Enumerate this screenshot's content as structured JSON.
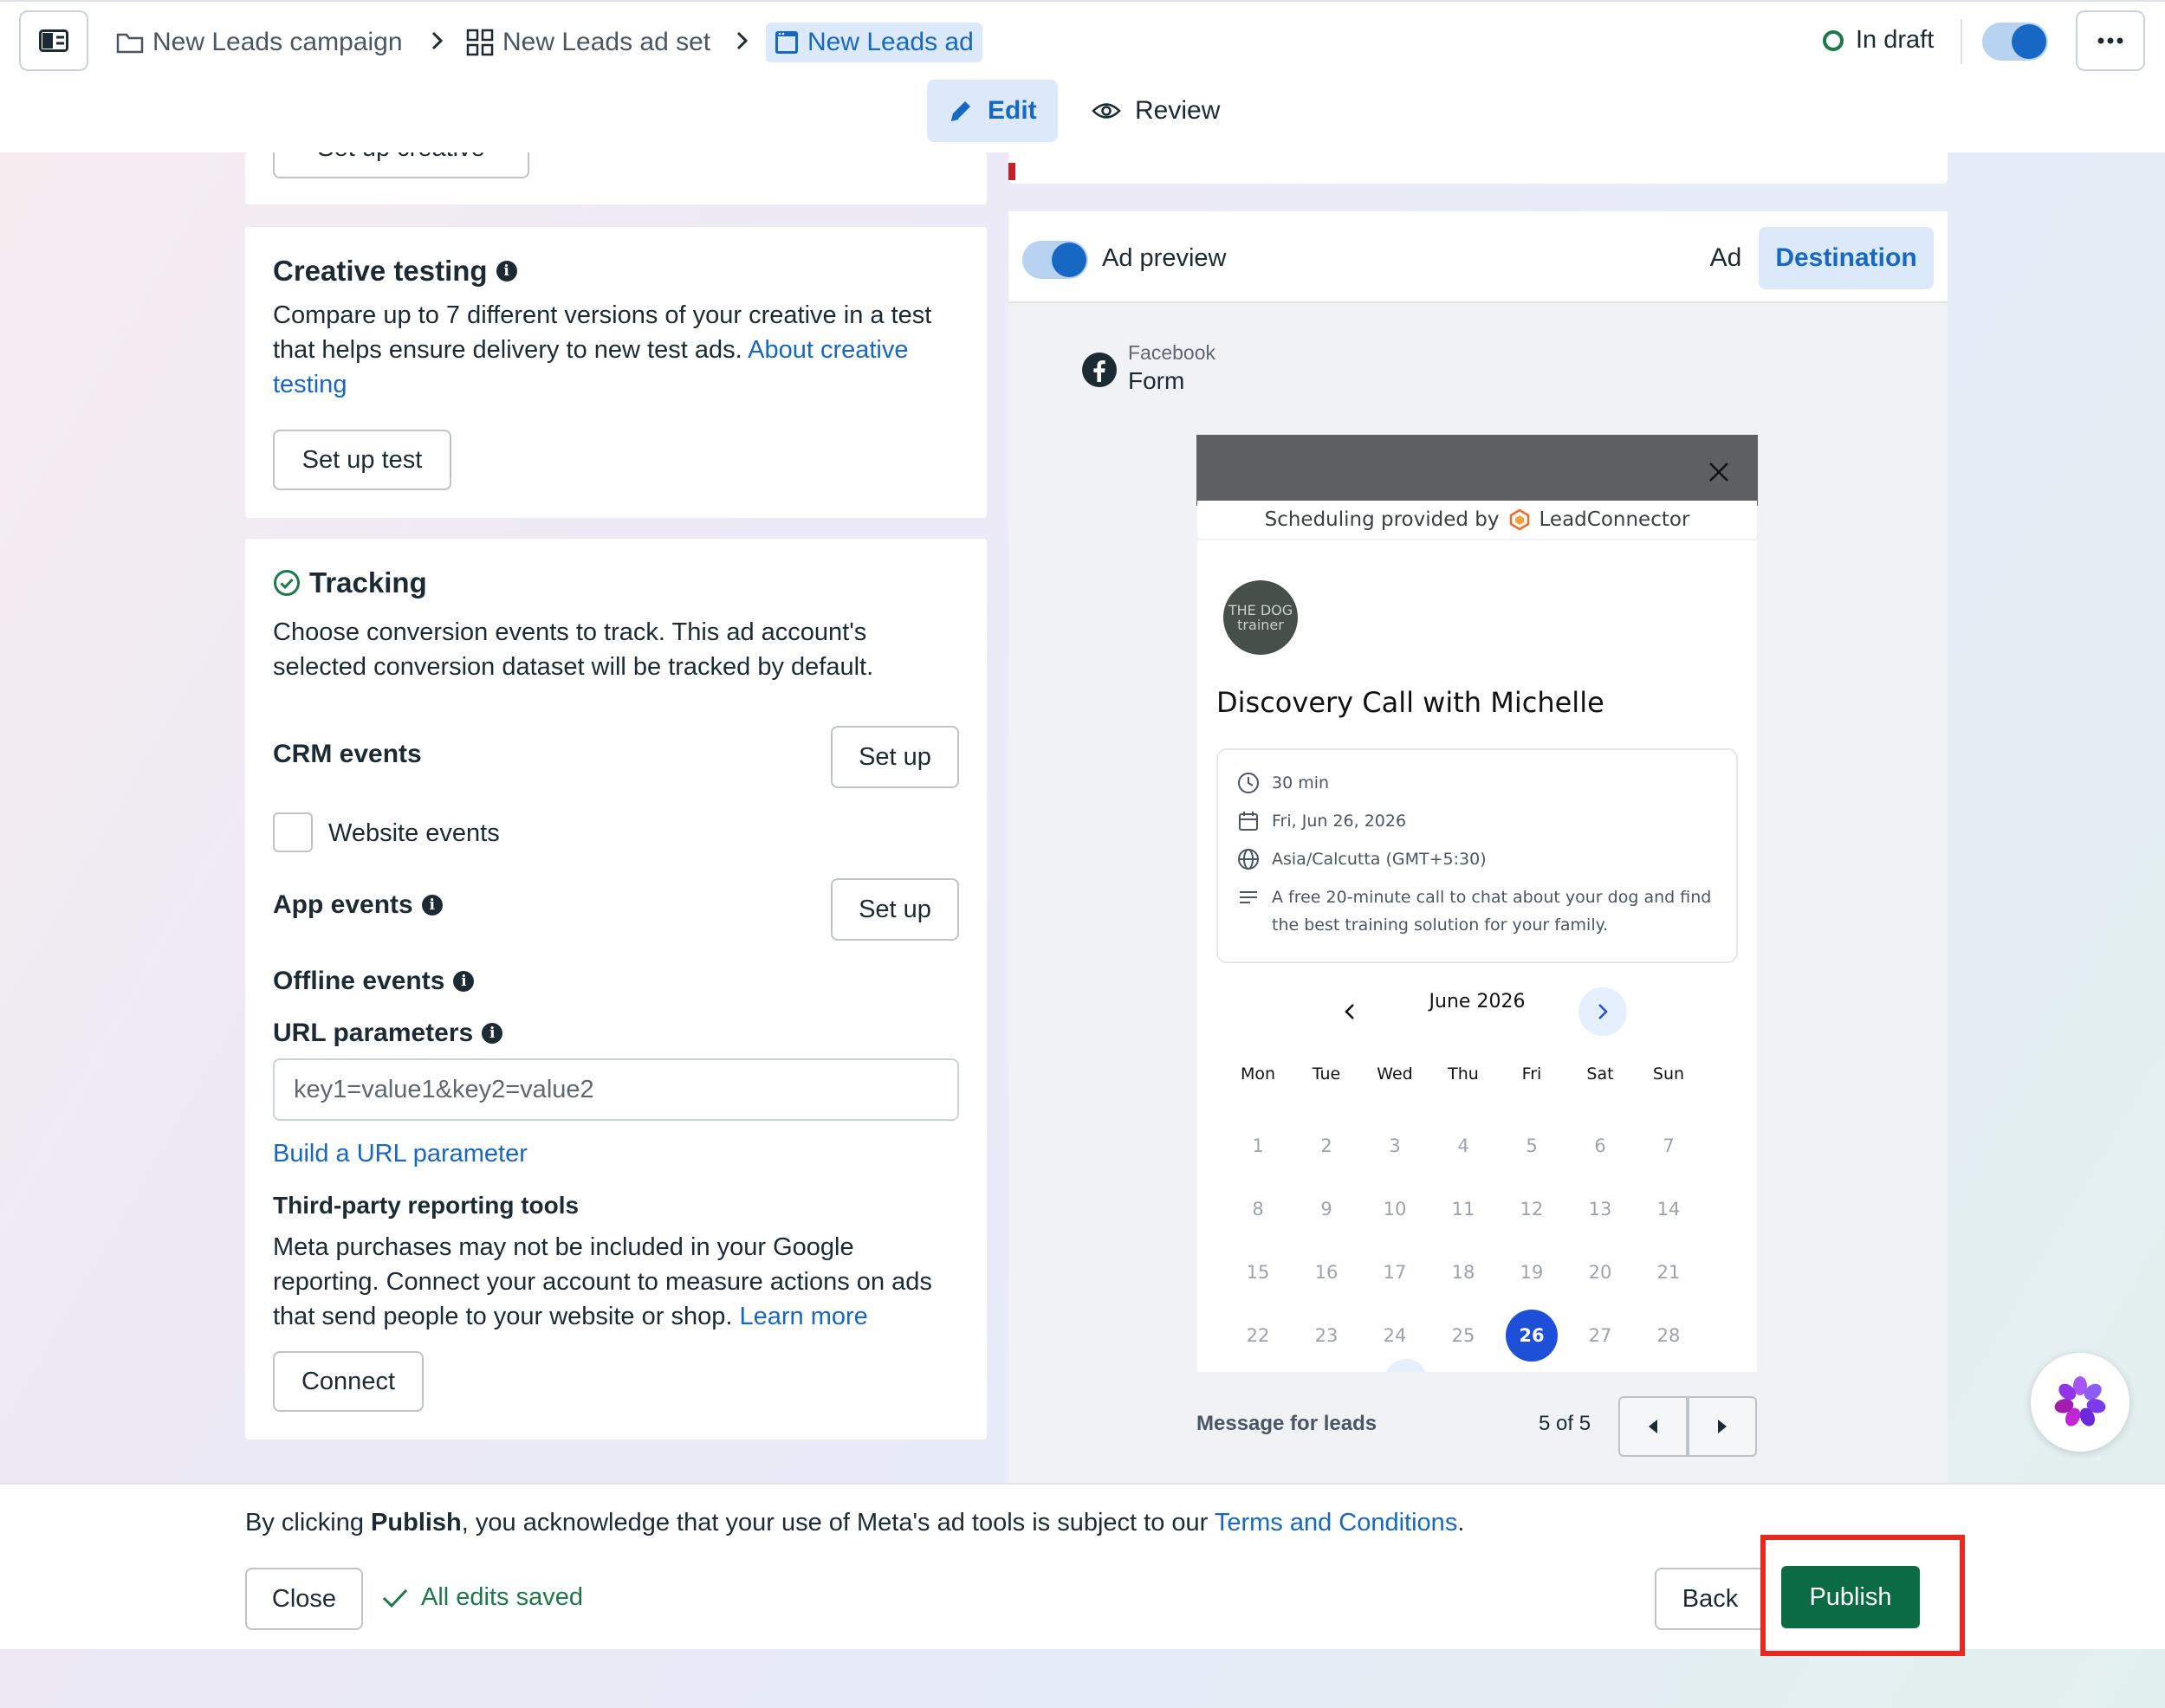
{
  "breadcrumb": {
    "campaign": "New Leads campaign",
    "ad_set": "New Leads ad set",
    "ad": "New Leads ad"
  },
  "status": {
    "label": "In draft"
  },
  "mode_tabs": {
    "edit": "Edit",
    "review": "Review"
  },
  "top_card": {
    "setup_creative_label": "Set up creative"
  },
  "creative_testing": {
    "title": "Creative testing",
    "description": "Compare up to 7 different versions of your creative in a test that helps ensure delivery to new test ads. ",
    "link": "About creative testing",
    "button": "Set up test"
  },
  "tracking": {
    "title": "Tracking",
    "description": "Choose conversion events to track. This ad account's selected conversion dataset will be tracked by default.",
    "crm_events": "CRM events",
    "crm_setup": "Set up",
    "website_events": "Website events",
    "app_events": "App events",
    "app_setup": "Set up",
    "offline_events": "Offline events",
    "url_parameters": "URL parameters",
    "url_placeholder": "key1=value1&key2=value2",
    "build_url_link": "Build a URL parameter",
    "third_party_title": "Third-party reporting tools",
    "third_party_text": "Meta purchases may not be included in your Google reporting. Connect your account to measure actions on ads that send people to your website or shop. ",
    "learn_more": "Learn more",
    "connect": "Connect"
  },
  "preview": {
    "toggle_label": "Ad preview",
    "tab_ad": "Ad",
    "tab_destination": "Destination",
    "platform": "Facebook",
    "placement": "Form",
    "scheduling_prefix": "Scheduling provided by",
    "scheduling_provider": "LeadConnector",
    "avatar_text": "THE DOG trainer",
    "meeting_title": "Discovery Call with Michelle",
    "duration": "30 min",
    "date": "Fri, Jun 26, 2026",
    "timezone": "Asia/Calcutta (GMT+5:30)",
    "description": "A free 20-minute call to chat about your dog and find the best training solution for your family.",
    "calendar": {
      "month": "June 2026",
      "weekdays": [
        "Mon",
        "Tue",
        "Wed",
        "Thu",
        "Fri",
        "Sat",
        "Sun"
      ],
      "weeks": [
        [
          "1",
          "2",
          "3",
          "4",
          "5",
          "6",
          "7"
        ],
        [
          "8",
          "9",
          "10",
          "11",
          "12",
          "13",
          "14"
        ],
        [
          "15",
          "16",
          "17",
          "18",
          "19",
          "20",
          "21"
        ],
        [
          "22",
          "23",
          "24",
          "25",
          "26",
          "27",
          "28"
        ]
      ],
      "selected": "26"
    },
    "message_label": "Message for leads",
    "pager": "5 of 5"
  },
  "footer": {
    "terms_prefix": "By clicking ",
    "terms_bold": "Publish",
    "terms_middle": ", you acknowledge that your use of Meta's ad tools is subject to our ",
    "terms_link": "Terms and Conditions",
    "terms_end": ".",
    "close": "Close",
    "saved": "All edits saved",
    "back": "Back",
    "publish": "Publish"
  },
  "colors": {
    "accent": "#1668c4",
    "publish": "#0b6b45",
    "saved": "#1a7a48",
    "highlight": "#e62a22",
    "selected_day": "#1d4fd8"
  }
}
